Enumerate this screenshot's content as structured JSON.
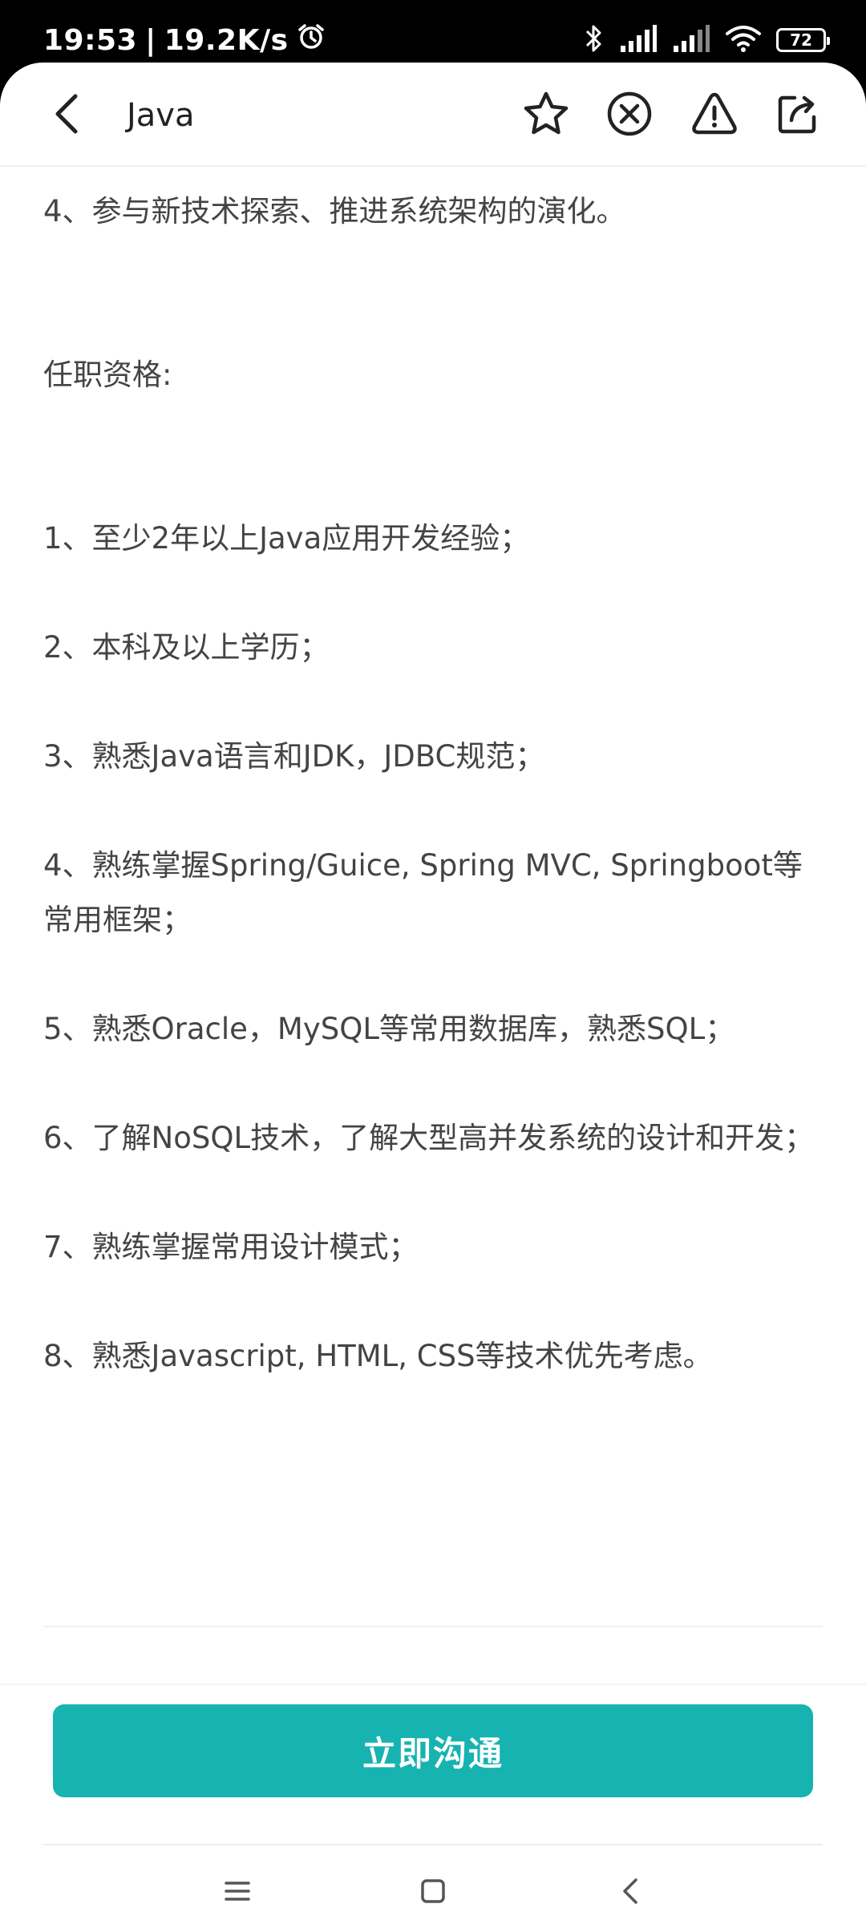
{
  "status_bar": {
    "time": "19:53",
    "separator": "|",
    "net_speed": "19.2K/s",
    "battery": "72"
  },
  "header": {
    "title": "Java"
  },
  "content": {
    "paragraphs": [
      "4、参与新技术探索、推进系统架构的演化。",
      "任职资格:",
      "1、至少2年以上Java应用开发经验；",
      "2、本科及以上学历；",
      "3、熟悉Java语言和JDK，JDBC规范；",
      "4、熟练掌握Spring/Guice, Spring MVC, Springboot等常用框架；",
      "5、熟悉Oracle，MySQL等常用数据库，熟悉SQL；",
      "6、了解NoSQL技术，了解大型高并发系统的设计和开发；",
      "7、熟练掌握常用设计模式；",
      "8、熟悉Javascript, HTML, CSS等技术优先考虑。"
    ]
  },
  "footer": {
    "chat_button": "立即沟通"
  },
  "colors": {
    "accent": "#16b3b0"
  },
  "icons": {
    "back": "chevron-left-icon",
    "favorite": "star-icon",
    "dismiss": "close-circle-icon",
    "report": "warning-icon",
    "share": "share-icon",
    "nav_menu": "menu-icon",
    "nav_home": "square-icon",
    "nav_back": "triangle-back-icon"
  }
}
